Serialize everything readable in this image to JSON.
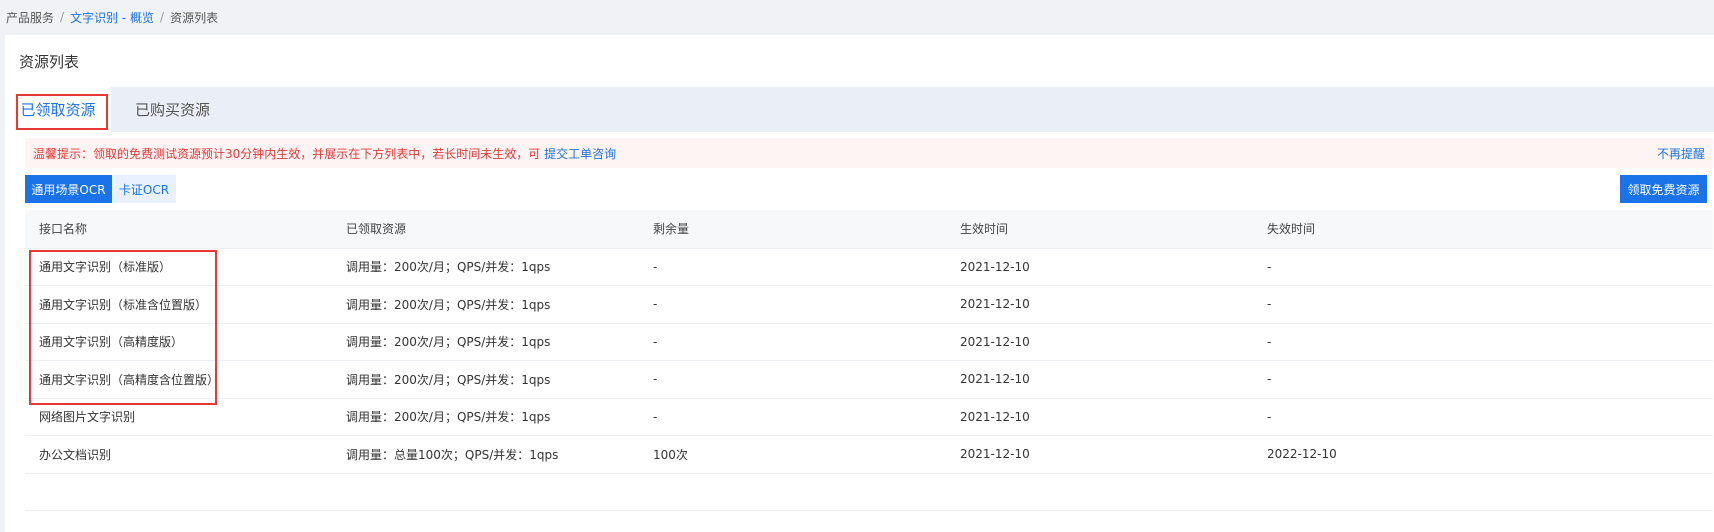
{
  "breadcrumb": {
    "items": [
      "产品服务",
      "文字识别 - 概览",
      "资源列表"
    ],
    "sep": "/"
  },
  "page_title": "资源列表",
  "tabs": [
    {
      "label": "已领取资源",
      "active": true
    },
    {
      "label": "已购买资源",
      "active": false
    }
  ],
  "notice": {
    "text": "温馨提示：领取的免费测试资源预计30分钟内生效，并展示在下方列表中，若长时间未生效，可 ",
    "link": "提交工单咨询",
    "dismiss": "不再提醒"
  },
  "subtabs": [
    {
      "label": "通用场景OCR",
      "active": true
    },
    {
      "label": "卡证OCR",
      "active": false
    }
  ],
  "claim_button": "领取免费资源",
  "table": {
    "headers": [
      "接口名称",
      "已领取资源",
      "剩余量",
      "生效时间",
      "失效时间"
    ],
    "rows": [
      [
        "通用文字识别（标准版）",
        "调用量：200次/月；QPS/并发：1qps",
        "-",
        "2021-12-10",
        "-"
      ],
      [
        "通用文字识别（标准含位置版）",
        "调用量：200次/月；QPS/并发：1qps",
        "-",
        "2021-12-10",
        "-"
      ],
      [
        "通用文字识别（高精度版）",
        "调用量：200次/月；QPS/并发：1qps",
        "-",
        "2021-12-10",
        "-"
      ],
      [
        "通用文字识别（高精度含位置版）",
        "调用量：200次/月；QPS/并发：1qps",
        "-",
        "2021-12-10",
        "-"
      ],
      [
        "网络图片文字识别",
        "调用量：200次/月；QPS/并发：1qps",
        "-",
        "2021-12-10",
        "-"
      ],
      [
        "办公文档识别",
        "调用量：总量100次；QPS/并发：1qps",
        "100次",
        "2021-12-10",
        "2022-12-10"
      ],
      [
        "",
        "",
        "",
        "",
        ""
      ]
    ]
  },
  "colors": {
    "accent": "#1a73e8",
    "highlight": "#e53935",
    "notice_bg": "#fff4f4"
  }
}
